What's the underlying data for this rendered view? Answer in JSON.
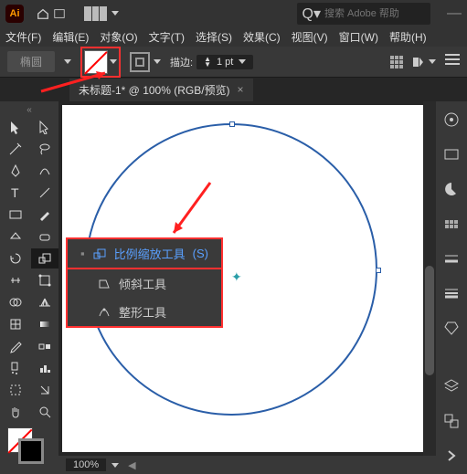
{
  "app": {
    "abbr": "Ai"
  },
  "search": {
    "placeholder": "搜索 Adobe 帮助"
  },
  "menubar": [
    "文件(F)",
    "编辑(E)",
    "对象(O)",
    "文字(T)",
    "选择(S)",
    "效果(C)",
    "视图(V)",
    "窗口(W)",
    "帮助(H)"
  ],
  "options": {
    "tool_label": "椭圆",
    "stroke_label": "描边:",
    "stroke_value": "1 pt"
  },
  "doc_tab": {
    "title": "未标题-1* @ 100% (RGB/预览)"
  },
  "flyout": {
    "items": [
      {
        "label": "比例缩放工具",
        "shortcut": "(S)",
        "highlight": true
      },
      {
        "label": "倾斜工具",
        "shortcut": "",
        "highlight": false
      },
      {
        "label": "整形工具",
        "shortcut": "",
        "highlight": false
      }
    ]
  },
  "status": {
    "zoom": "100%"
  }
}
